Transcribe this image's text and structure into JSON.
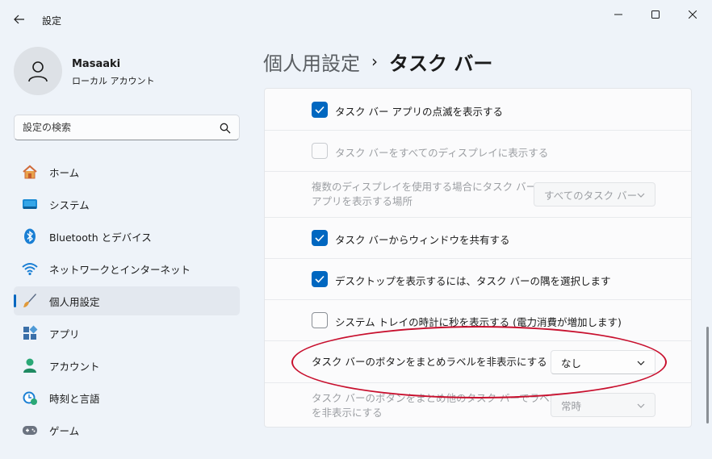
{
  "window": {
    "app_title": "設定",
    "back_icon": "back-arrow-icon",
    "controls": [
      "minimize-icon",
      "maximize-icon",
      "close-icon"
    ]
  },
  "profile": {
    "name": "Masaaki",
    "account_type": "ローカル アカウント"
  },
  "search": {
    "placeholder": "設定の検索",
    "value": ""
  },
  "nav": {
    "items": [
      {
        "label": "ホーム",
        "icon": "home-icon",
        "active": false
      },
      {
        "label": "システム",
        "icon": "system-icon",
        "active": false
      },
      {
        "label": "Bluetooth とデバイス",
        "icon": "bluetooth-icon",
        "active": false
      },
      {
        "label": "ネットワークとインターネット",
        "icon": "wifi-icon",
        "active": false
      },
      {
        "label": "個人用設定",
        "icon": "brush-icon",
        "active": true
      },
      {
        "label": "アプリ",
        "icon": "apps-icon",
        "active": false
      },
      {
        "label": "アカウント",
        "icon": "account-icon",
        "active": false
      },
      {
        "label": "時刻と言語",
        "icon": "time-language-icon",
        "active": false
      },
      {
        "label": "ゲーム",
        "icon": "gamepad-icon",
        "active": false
      }
    ]
  },
  "breadcrumb": {
    "parent": "個人用設定",
    "separator": "›",
    "current": "タスク バー"
  },
  "settings": {
    "flash_apps": {
      "label": "タスク バー アプリの点滅を表示する",
      "checked": true
    },
    "all_displays": {
      "label": "タスク バーをすべてのディスプレイに表示する",
      "checked": false,
      "disabled": true
    },
    "multi_display": {
      "label_line1": "複数のディスプレイを使用する場合にタスク バー",
      "label_line2": "アプリを表示する場所",
      "value": "すべてのタスク バー",
      "disabled": true
    },
    "share_window": {
      "label": "タスク バーからウィンドウを共有する",
      "checked": true
    },
    "show_desktop": {
      "label": "デスクトップを表示するには、タスク バーの隅を選択します",
      "checked": true
    },
    "clock_seconds": {
      "label": "システム トレイの時計に秒を表示する (電力消費が増加します)",
      "checked": false
    },
    "combine_buttons": {
      "label": "タスク バーのボタンをまとめラベルを非表示にする",
      "value": "なし"
    },
    "combine_other": {
      "label_line1": "タスク バーのボタンをまとめ他のタスク バーでラベル",
      "label_line2": "を非表示にする",
      "value": "常時",
      "disabled": true
    }
  },
  "colors": {
    "accent": "#0067c0",
    "annotation": "#c8102e"
  }
}
